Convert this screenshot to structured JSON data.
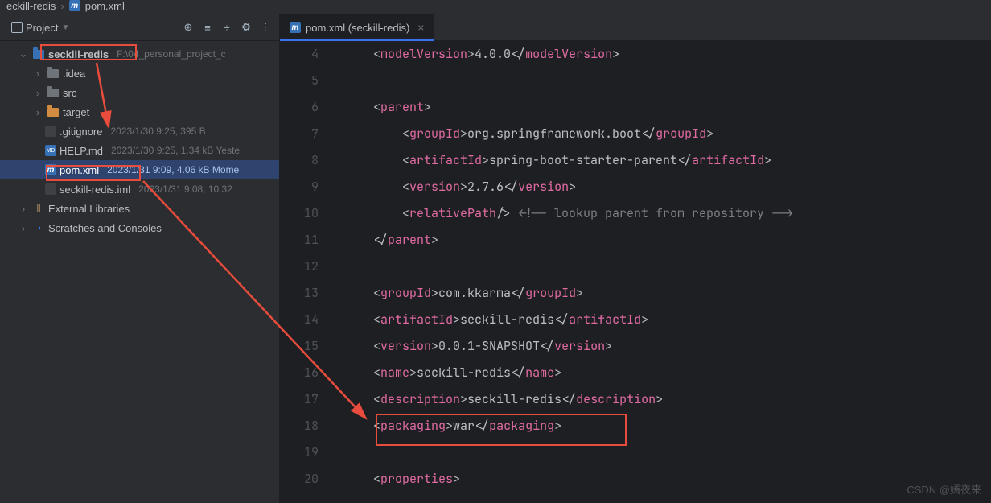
{
  "breadcrumb": {
    "part1": "eckill-redis",
    "part2": "pom.xml"
  },
  "toolbar": {
    "project_label": "Project"
  },
  "tree": {
    "root": {
      "name": "seckill-redis",
      "path": "F:\\04_personal_project_c"
    },
    "idea": ".idea",
    "src": "src",
    "target": "target",
    "gitignore": {
      "name": ".gitignore",
      "meta": "2023/1/30 9:25, 395 B"
    },
    "help": {
      "name": "HELP.md",
      "meta": "2023/1/30 9:25, 1.34 kB  Yeste"
    },
    "pom": {
      "name": "pom.xml",
      "meta": "2023/1/31 9:09, 4.06 kB  Mome"
    },
    "iml": {
      "name": "seckill-redis.iml",
      "meta": "2023/1/31 9:08, 10.32"
    },
    "ext": "External Libraries",
    "scratch": "Scratches and Consoles"
  },
  "tab": {
    "label": "pom.xml (seckill-redis)"
  },
  "gutter": [
    "4",
    "5",
    "6",
    "7",
    "8",
    "9",
    "10",
    "11",
    "12",
    "13",
    "14",
    "15",
    "16",
    "17",
    "18",
    "19",
    "20"
  ],
  "code": {
    "l4_a": "modelVersion",
    "l4_v": "4.0.0",
    "l6": "parent",
    "l7": "groupId",
    "l7_v": "org.springframework.boot",
    "l8": "artifactId",
    "l8_v": "spring-boot-starter-parent",
    "l9": "version",
    "l9_v": "2.7.6",
    "l10": "relativePath",
    "l10_c": "<!-- lookup parent from repository -->",
    "l11": "parent",
    "l13": "groupId",
    "l13_v": "com.kkarma",
    "l14": "artifactId",
    "l14_v": "seckill-redis",
    "l15": "version",
    "l15_v": "0.0.1-SNAPSHOT",
    "l16": "name",
    "l16_v": "seckill-redis",
    "l17": "description",
    "l17_v": "seckill-redis",
    "l18": "packaging",
    "l18_v": "war",
    "l20": "properties"
  },
  "watermark": "CSDN @嫣夜来"
}
